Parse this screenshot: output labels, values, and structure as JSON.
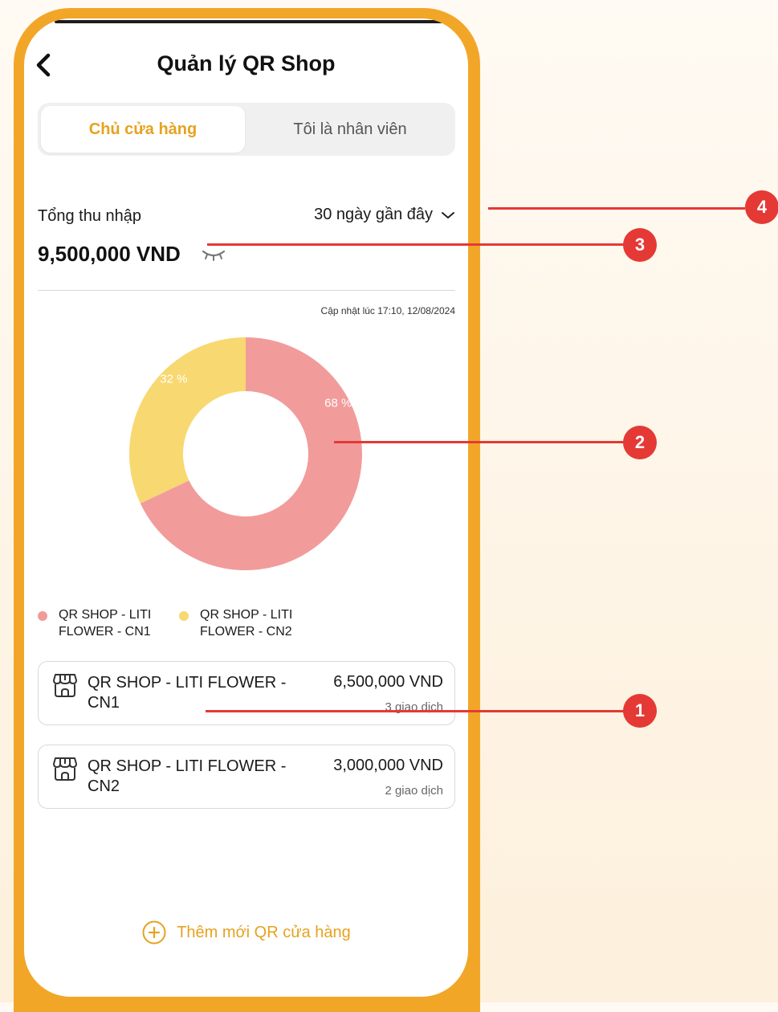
{
  "header": {
    "title": "Quản lý QR Shop",
    "back_icon": "chevron-left-icon"
  },
  "tabs": [
    {
      "label": "Chủ cửa hàng",
      "active": true
    },
    {
      "label": "Tôi là nhân viên",
      "active": false
    }
  ],
  "income": {
    "label": "Tổng thu nhập",
    "period": "30 ngày gần đây",
    "amount": "9,500,000 VND",
    "visibility_icon": "eye-closed-icon",
    "updated": "Cập nhật lúc 17:10, 12/08/2024"
  },
  "chart_data": {
    "type": "pie",
    "donut": true,
    "categories": [
      "QR SHOP - LITI FLOWER - CN1",
      "QR SHOP - LITI FLOWER - CN2"
    ],
    "values": [
      68,
      32
    ],
    "labels": [
      "68 %",
      "32 %"
    ],
    "colors": [
      "#f29b9b",
      "#f8d870"
    ]
  },
  "legend": [
    {
      "label": "QR SHOP - LITI FLOWER - CN1",
      "color": "#f29b9b"
    },
    {
      "label": "QR SHOP - LITI FLOWER - CN2",
      "color": "#f8d870"
    }
  ],
  "shops": [
    {
      "name": "QR SHOP - LITI FLOWER - CN1",
      "amount": "6,500,000 VND",
      "count": "3 giao dịch",
      "icon": "storefront-icon"
    },
    {
      "name": "QR SHOP - LITI FLOWER - CN2",
      "amount": "3,000,000 VND",
      "count": "2 giao dịch",
      "icon": "storefront-icon"
    }
  ],
  "add_button": {
    "label": "Thêm mới QR cửa hàng",
    "icon": "plus-circle-icon"
  },
  "callouts": [
    "1",
    "2",
    "3",
    "4"
  ],
  "colors": {
    "accent": "#e6a220",
    "frame": "#f2a628",
    "callout": "#e53935"
  }
}
